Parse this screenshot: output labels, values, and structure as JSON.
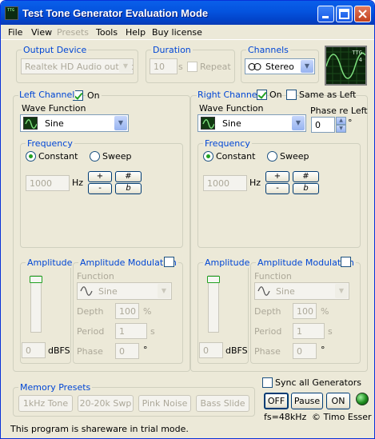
{
  "window": {
    "title": "Test Tone Generator Evaluation Mode",
    "icon_text": "TTG"
  },
  "menu": [
    "File",
    "View",
    "Presets",
    "Tools",
    "Help",
    "Buy license"
  ],
  "output_device": {
    "label": "Output Device",
    "value": "Realtek HD Audio output"
  },
  "duration": {
    "label": "Duration",
    "value": "10",
    "unit": "s",
    "repeat_label": "Repeat"
  },
  "channels": {
    "label": "Channels",
    "value": "Stereo"
  },
  "scope": {
    "logo_top": "TTG",
    "logo_bottom": "4"
  },
  "left": {
    "channel_label": "Left Channel",
    "on_label": "On",
    "wave_label": "Wave Function",
    "wave_value": "Sine",
    "frequency_label": "Frequency",
    "constant_label": "Constant",
    "sweep_label": "Sweep",
    "freq_value": "1000",
    "freq_unit": "Hz",
    "plus": "+",
    "minus": "-",
    "sharp": "#",
    "flat": "b",
    "amplitude_label": "Amplitude",
    "amp_value": "0",
    "amp_unit": "dBFS",
    "am_label": "Amplitude Modulation",
    "function_label": "Function",
    "function_value": "Sine",
    "depth_label": "Depth",
    "depth_value": "100",
    "depth_unit": "%",
    "period_label": "Period",
    "period_value": "1",
    "period_unit": "s",
    "phase_label": "Phase",
    "phase_value": "0",
    "phase_unit": "°"
  },
  "right": {
    "channel_label": "Right Channel",
    "on_label": "On",
    "same_label": "Same as Left",
    "wave_label": "Wave Function",
    "wave_value": "Sine",
    "phase_re_left_label": "Phase re Left",
    "phase_re_left_value": "0",
    "phase_re_left_unit": "°",
    "frequency_label": "Frequency",
    "constant_label": "Constant",
    "sweep_label": "Sweep",
    "freq_value": "1000",
    "freq_unit": "Hz",
    "plus": "+",
    "minus": "-",
    "sharp": "#",
    "flat": "b",
    "amplitude_label": "Amplitude",
    "amp_value": "0",
    "amp_unit": "dBFS",
    "am_label": "Amplitude Modulation",
    "function_label": "Function",
    "function_value": "Sine",
    "depth_label": "Depth",
    "depth_value": "100",
    "depth_unit": "%",
    "period_label": "Period",
    "period_value": "1",
    "period_unit": "s",
    "phase_label": "Phase",
    "phase_value": "0",
    "phase_unit": "°"
  },
  "presets": {
    "label": "Memory Presets",
    "items": [
      "1kHz Tone",
      "20-20k Swp",
      "Pink Noise",
      "Bass Slide"
    ]
  },
  "sync_label": "Sync all Generators",
  "controls": {
    "off": "OFF",
    "pause": "Pause",
    "on": "ON"
  },
  "sample_rate": "fs=48kHz",
  "copyright": "© Timo Esser",
  "status_text": "This program is shareware in trial mode.",
  "colors": {
    "titlebar": "#0453de",
    "group_label": "#0046d5",
    "window_bg": "#ece9d8",
    "led": "#1e8c1e"
  }
}
